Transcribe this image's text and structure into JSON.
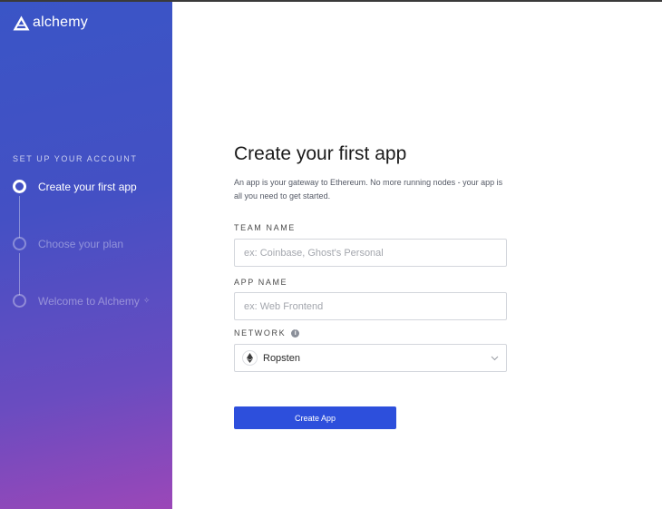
{
  "brand": {
    "name": "alchemy"
  },
  "sidebar": {
    "section_label": "SET UP YOUR ACCOUNT",
    "steps": [
      {
        "label": "Create your first app",
        "active": true
      },
      {
        "label": "Choose your plan",
        "active": false
      },
      {
        "label": "Welcome to Alchemy",
        "active": false
      }
    ]
  },
  "main": {
    "title": "Create your first app",
    "description": "An app is your gateway to Ethereum. No more running nodes - your app is all you need to get started.",
    "team_name": {
      "label": "TEAM NAME",
      "placeholder": "ex: Coinbase, Ghost's Personal",
      "value": ""
    },
    "app_name": {
      "label": "APP NAME",
      "placeholder": "ex: Web Frontend",
      "value": ""
    },
    "network": {
      "label": "NETWORK",
      "info_icon": "info-icon",
      "selected": "Ropsten",
      "icon": "ethereum-icon"
    },
    "submit_label": "Create App"
  },
  "colors": {
    "accent": "#2d4fdc",
    "sidebar_gradient_start": "#3a55c6",
    "sidebar_gradient_end": "#9b47b8"
  }
}
